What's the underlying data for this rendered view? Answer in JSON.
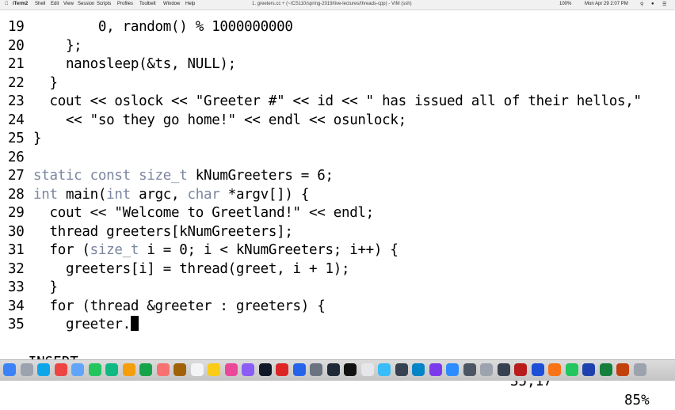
{
  "menubar": {
    "app": "iTerm2",
    "menus": [
      "Shell",
      "Edit",
      "View",
      "Session",
      "Scripts",
      "Profiles",
      "Toolbelt",
      "Window",
      "Help"
    ],
    "window_title": "1. greeters.cc + (~/CS110/spring-2019/live-lectures/threads-cpp) - VIM (ssh)",
    "battery": "100%",
    "datetime": "Mon Apr 29  2:07 PM"
  },
  "editor": {
    "lines": [
      {
        "num": "19",
        "code": "        0, random() % 1000000000"
      },
      {
        "num": "20",
        "code": "    };"
      },
      {
        "num": "21",
        "code": "    nanosleep(&ts, NULL);"
      },
      {
        "num": "22",
        "code": "  }"
      },
      {
        "num": "23",
        "code": "  cout << oslock << \"Greeter #\" << id << \" has issued all of their hellos,\""
      },
      {
        "num": "24",
        "code": "    << \"so they go home!\" << endl << osunlock;"
      },
      {
        "num": "25",
        "code": "}"
      },
      {
        "num": "26",
        "code": ""
      },
      {
        "num": "27",
        "kw": "static const size_t",
        "code": " kNumGreeters = 6;"
      },
      {
        "num": "28",
        "kw": "int",
        "code": " main(",
        "kw2": "int",
        "code2": " argc, ",
        "kw3": "char",
        "code3": " *argv[]) {"
      },
      {
        "num": "29",
        "code": "  cout << \"Welcome to Greetland!\" << endl;"
      },
      {
        "num": "30",
        "code": "  thread greeters[kNumGreeters];"
      },
      {
        "num": "31",
        "code": "  for (",
        "kw": "size_t",
        "code2": " i = 0; i < kNumGreeters; i++) {"
      },
      {
        "num": "32",
        "code": "    greeters[i] = thread(greet, i + 1);"
      },
      {
        "num": "33",
        "code": "  }"
      },
      {
        "num": "34",
        "code": "  for (thread &greeter : greeters) {"
      },
      {
        "num": "35",
        "code": "    greeter."
      }
    ]
  },
  "status": {
    "mode": "-- INSERT --",
    "position": "35,17",
    "percent": "85%"
  },
  "colors": {
    "keyword": "#7b86a0",
    "text": "#000000",
    "background": "#ffffff"
  },
  "dock": {
    "icons": [
      "finder-icon",
      "launchpad-icon",
      "safari-icon",
      "chrome-icon",
      "mail-icon",
      "messages-icon",
      "maps-icon",
      "photos-icon",
      "facetime-icon",
      "calendar-icon",
      "contacts-icon",
      "reminders-icon",
      "notes-icon",
      "music-icon",
      "podcasts-icon",
      "tv-icon",
      "news-icon",
      "appstore-icon",
      "preferences-icon",
      "terminal-icon",
      "iterm-icon",
      "textedit-icon",
      "preview-icon",
      "quicktime-icon",
      "xcode-icon",
      "slack-icon",
      "zoom-icon",
      "activity-icon",
      "disk-utility-icon",
      "console-icon",
      "photobooth-icon",
      "keynote-icon",
      "pages-icon",
      "numbers-icon",
      "word-icon",
      "excel-icon",
      "powerpoint-icon",
      "trash-icon"
    ]
  }
}
